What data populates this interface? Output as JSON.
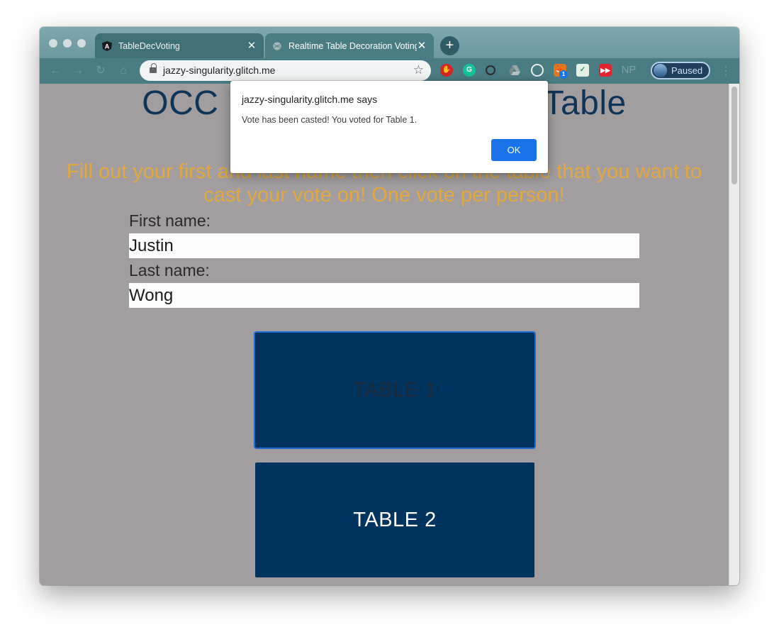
{
  "browser": {
    "tabs": [
      {
        "title": "TableDecVoting",
        "favicon": "angular-icon",
        "active": false
      },
      {
        "title": "Realtime Table Decoration Voting",
        "favicon": "globe-icon",
        "active": true
      }
    ],
    "new_tab": "+",
    "url": "jazzy-singularity.glitch.me",
    "profile_label": "Paused",
    "extensions": [
      "ublock-icon",
      "grammarly-icon",
      "circle-icon",
      "drive-icon",
      "target-icon",
      "metamask-icon",
      "mail-check-icon",
      "youtube-icon",
      "np-icon"
    ],
    "extension_badge": "1",
    "np_label": "NP"
  },
  "page": {
    "heading_left": "OCC",
    "heading_right": "Table",
    "instructions": "Fill out your first and last name then click on the table that you want to cast your vote on! One vote per person!",
    "first_name_label": "First name:",
    "first_name_value": "Justin",
    "last_name_label": "Last name:",
    "last_name_value": "Wong",
    "table1_label": "TABLE 1",
    "table2_label": "TABLE 2"
  },
  "dialog": {
    "origin": "jazzy-singularity.glitch.me says",
    "message": "Vote has been casted! You voted for Table 1.",
    "ok_label": "OK"
  },
  "colors": {
    "heading": "#0e3457",
    "instructions": "#e0a83e",
    "table_button": "#00335d",
    "ok_button": "#1a73e8"
  }
}
